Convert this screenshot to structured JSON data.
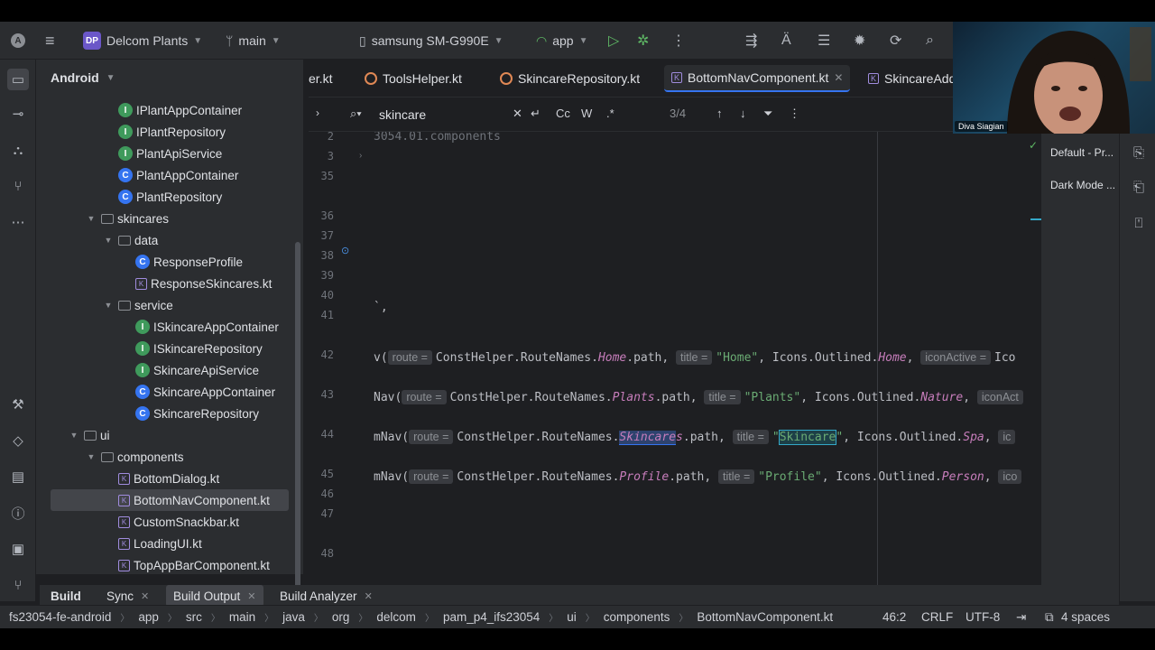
{
  "topbar": {
    "project_badge": "DP",
    "project_name": "Delcom Plants",
    "branch": "main",
    "device": "samsung SM-G990E",
    "run_config": "app"
  },
  "project_panel": {
    "title": "Android",
    "items": [
      {
        "label": "IPlantAppContainer",
        "icon": "interface-icon",
        "indent": 3
      },
      {
        "label": "IPlantRepository",
        "icon": "interface-icon",
        "indent": 3
      },
      {
        "label": "PlantApiService",
        "icon": "interface-icon",
        "indent": 3
      },
      {
        "label": "PlantAppContainer",
        "icon": "class-icon",
        "indent": 3
      },
      {
        "label": "PlantRepository",
        "icon": "class-icon",
        "indent": 3
      },
      {
        "label": "skincares",
        "icon": "folder-icon",
        "indent": 2,
        "expanded": true
      },
      {
        "label": "data",
        "icon": "folder-icon",
        "indent": 3,
        "expanded": true
      },
      {
        "label": "ResponseProfile",
        "icon": "class-icon",
        "indent": 4
      },
      {
        "label": "ResponseSkincares.kt",
        "icon": "kotlin-file-icon",
        "indent": 4
      },
      {
        "label": "service",
        "icon": "folder-icon",
        "indent": 3,
        "expanded": true
      },
      {
        "label": "ISkincareAppContainer",
        "icon": "interface-icon",
        "indent": 4
      },
      {
        "label": "ISkincareRepository",
        "icon": "interface-icon",
        "indent": 4
      },
      {
        "label": "SkincareApiService",
        "icon": "interface-icon",
        "indent": 4
      },
      {
        "label": "SkincareAppContainer",
        "icon": "class-icon",
        "indent": 4
      },
      {
        "label": "SkincareRepository",
        "icon": "class-icon",
        "indent": 4
      },
      {
        "label": "ui",
        "icon": "folder-icon",
        "indent": 1,
        "expanded": true
      },
      {
        "label": "components",
        "icon": "folder-icon",
        "indent": 2,
        "expanded": true
      },
      {
        "label": "BottomDialog.kt",
        "icon": "kotlin-file-icon",
        "indent": 3
      },
      {
        "label": "BottomNavComponent.kt",
        "icon": "kotlin-file-icon",
        "indent": 3,
        "selected": true
      },
      {
        "label": "CustomSnackbar.kt",
        "icon": "kotlin-file-icon",
        "indent": 3
      },
      {
        "label": "LoadingUI.kt",
        "icon": "kotlin-file-icon",
        "indent": 3
      },
      {
        "label": "TopAppBarComponent.kt",
        "icon": "kotlin-file-icon",
        "indent": 3
      }
    ]
  },
  "editor_tabs": [
    {
      "label": "er.kt",
      "icon": "object-icon"
    },
    {
      "label": "ToolsHelper.kt",
      "icon": "object-icon"
    },
    {
      "label": "SkincareRepository.kt",
      "icon": "class-icon"
    },
    {
      "label": "BottomNavComponent.kt",
      "icon": "kotlin-file-icon",
      "active": true
    },
    {
      "label": "SkincareAdd",
      "icon": "kotlin-file-icon"
    }
  ],
  "search": {
    "query": "skincare",
    "match_case": "Cc",
    "words": "W",
    "regex": ".*",
    "result_count": "3/4"
  },
  "code": {
    "line_numbers": [
      "2",
      "3",
      "35",
      "36",
      "37",
      "38",
      "39",
      "40",
      "41",
      "42",
      "43",
      "44",
      "45",
      "46",
      "47",
      "48"
    ],
    "l1": "3054.01.components",
    "l40": "`,",
    "l42": {
      "prefix": "v(",
      "route_hint": "route =",
      "route_pre": "ConstHelper.RouteNames.",
      "route_obj": "Home",
      "route_post": ".path,",
      "title_hint": "title =",
      "title_val": "\"Home\"",
      "icons_pre": ", Icons.Outlined.",
      "icon": "Home",
      "icon_hint": "iconActive =",
      "tail": "Ico"
    },
    "l43": {
      "prefix": "Nav(",
      "route_hint": "route =",
      "route_pre": "ConstHelper.RouteNames.",
      "route_obj": "Plants",
      "route_post": ".path,",
      "title_hint": "title =",
      "title_val": "\"Plants\"",
      "icons_pre": ", Icons.Outlined.",
      "icon": "Nature",
      "icon_hint": "iconAct"
    },
    "l44": {
      "prefix": "mNav(",
      "route_hint": "route =",
      "route_pre": "ConstHelper.RouteNames.",
      "route_obj_match": "Skincare",
      "route_obj_rest": "s",
      "route_post": ".path,",
      "title_hint": "title =",
      "title_q1": "\"",
      "title_match": "Skincare",
      "title_q2": "\"",
      "icons_pre": ", Icons.Outlined.",
      "icon": "Spa",
      "icon_hint": "ic"
    },
    "l45": {
      "prefix": "mNav(",
      "route_hint": "route =",
      "route_pre": "ConstHelper.RouteNames.",
      "route_obj": "Profile",
      "route_post": ".path,",
      "title_hint": "title =",
      "title_val": "\"Profile\"",
      "icons_pre": ", Icons.Outlined.",
      "icon": "Person",
      "icon_hint": "ico"
    }
  },
  "right_panel": {
    "item1": "Default - Pr...",
    "item2": "Dark Mode ..."
  },
  "bottom_tabs": [
    {
      "label": "Build"
    },
    {
      "label": "Sync"
    },
    {
      "label": "Build Output",
      "active": true
    },
    {
      "label": "Build Analyzer"
    }
  ],
  "statusbar": {
    "crumbs": [
      "fs23054-fe-android",
      "app",
      "src",
      "main",
      "java",
      "org",
      "delcom",
      "pam_p4_ifs23054",
      "ui",
      "components",
      "BottomNavComponent.kt"
    ],
    "position": "46:2",
    "line_sep": "CRLF",
    "encoding": "UTF-8",
    "indent": "4 spaces"
  },
  "webcam": {
    "name": "Diva Siagian"
  },
  "colors": {
    "accent": "#3574f0",
    "bg": "#1e1f22",
    "panel": "#2b2d30",
    "run_green": "#5fb865",
    "kotlin_purple": "#a08cde"
  }
}
